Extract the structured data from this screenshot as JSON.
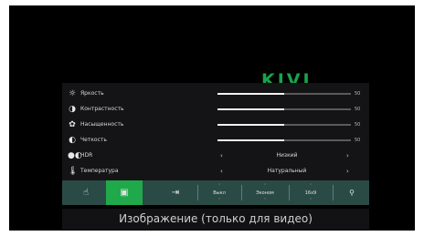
{
  "logo": {
    "text": "KIVI",
    "color": "#19a34a"
  },
  "settings": [
    {
      "icon": "brightness-icon",
      "label": "Яркость",
      "value": "50",
      "level": 0.5
    },
    {
      "icon": "contrast-icon",
      "label": "Контрастность",
      "value": "50",
      "level": 0.5
    },
    {
      "icon": "palette-icon",
      "label": "Насыщенность",
      "value": "50",
      "level": 0.5
    },
    {
      "icon": "sharpness-icon",
      "label": "Четкость",
      "value": "50",
      "level": 0.5
    }
  ],
  "selectors": [
    {
      "icon": "hdr-icon",
      "label": "HDR",
      "value": "Низкий",
      "left_arrow": "‹",
      "right_arrow": "›"
    },
    {
      "icon": "thermometer-icon",
      "label": "Температура",
      "value": "Натуральный",
      "left_arrow": "‹",
      "right_arrow": "›"
    }
  ],
  "toolbar": {
    "buttons": [
      {
        "id": "power",
        "icon": "power-hand-icon",
        "glyph": "☝",
        "active": false
      },
      {
        "id": "picture",
        "icon": "picture-icon",
        "glyph": "▣",
        "active": true
      },
      {
        "id": "input",
        "icon": "input-source-icon",
        "glyph": "⇥",
        "active": false
      },
      {
        "id": "sleep",
        "label": "Выкл",
        "up": "˄",
        "down": "˅"
      },
      {
        "id": "eco",
        "label": "Эконом",
        "up": "˄",
        "down": "˅"
      },
      {
        "id": "aspect",
        "label": "16x9",
        "up": "˄",
        "down": "˅"
      },
      {
        "id": "network",
        "icon": "network-icon",
        "glyph": "⚲",
        "active": false
      }
    ],
    "background": "#2a4a46",
    "active_color": "#1fa94a"
  },
  "caption": "Изображение (только для видео)"
}
